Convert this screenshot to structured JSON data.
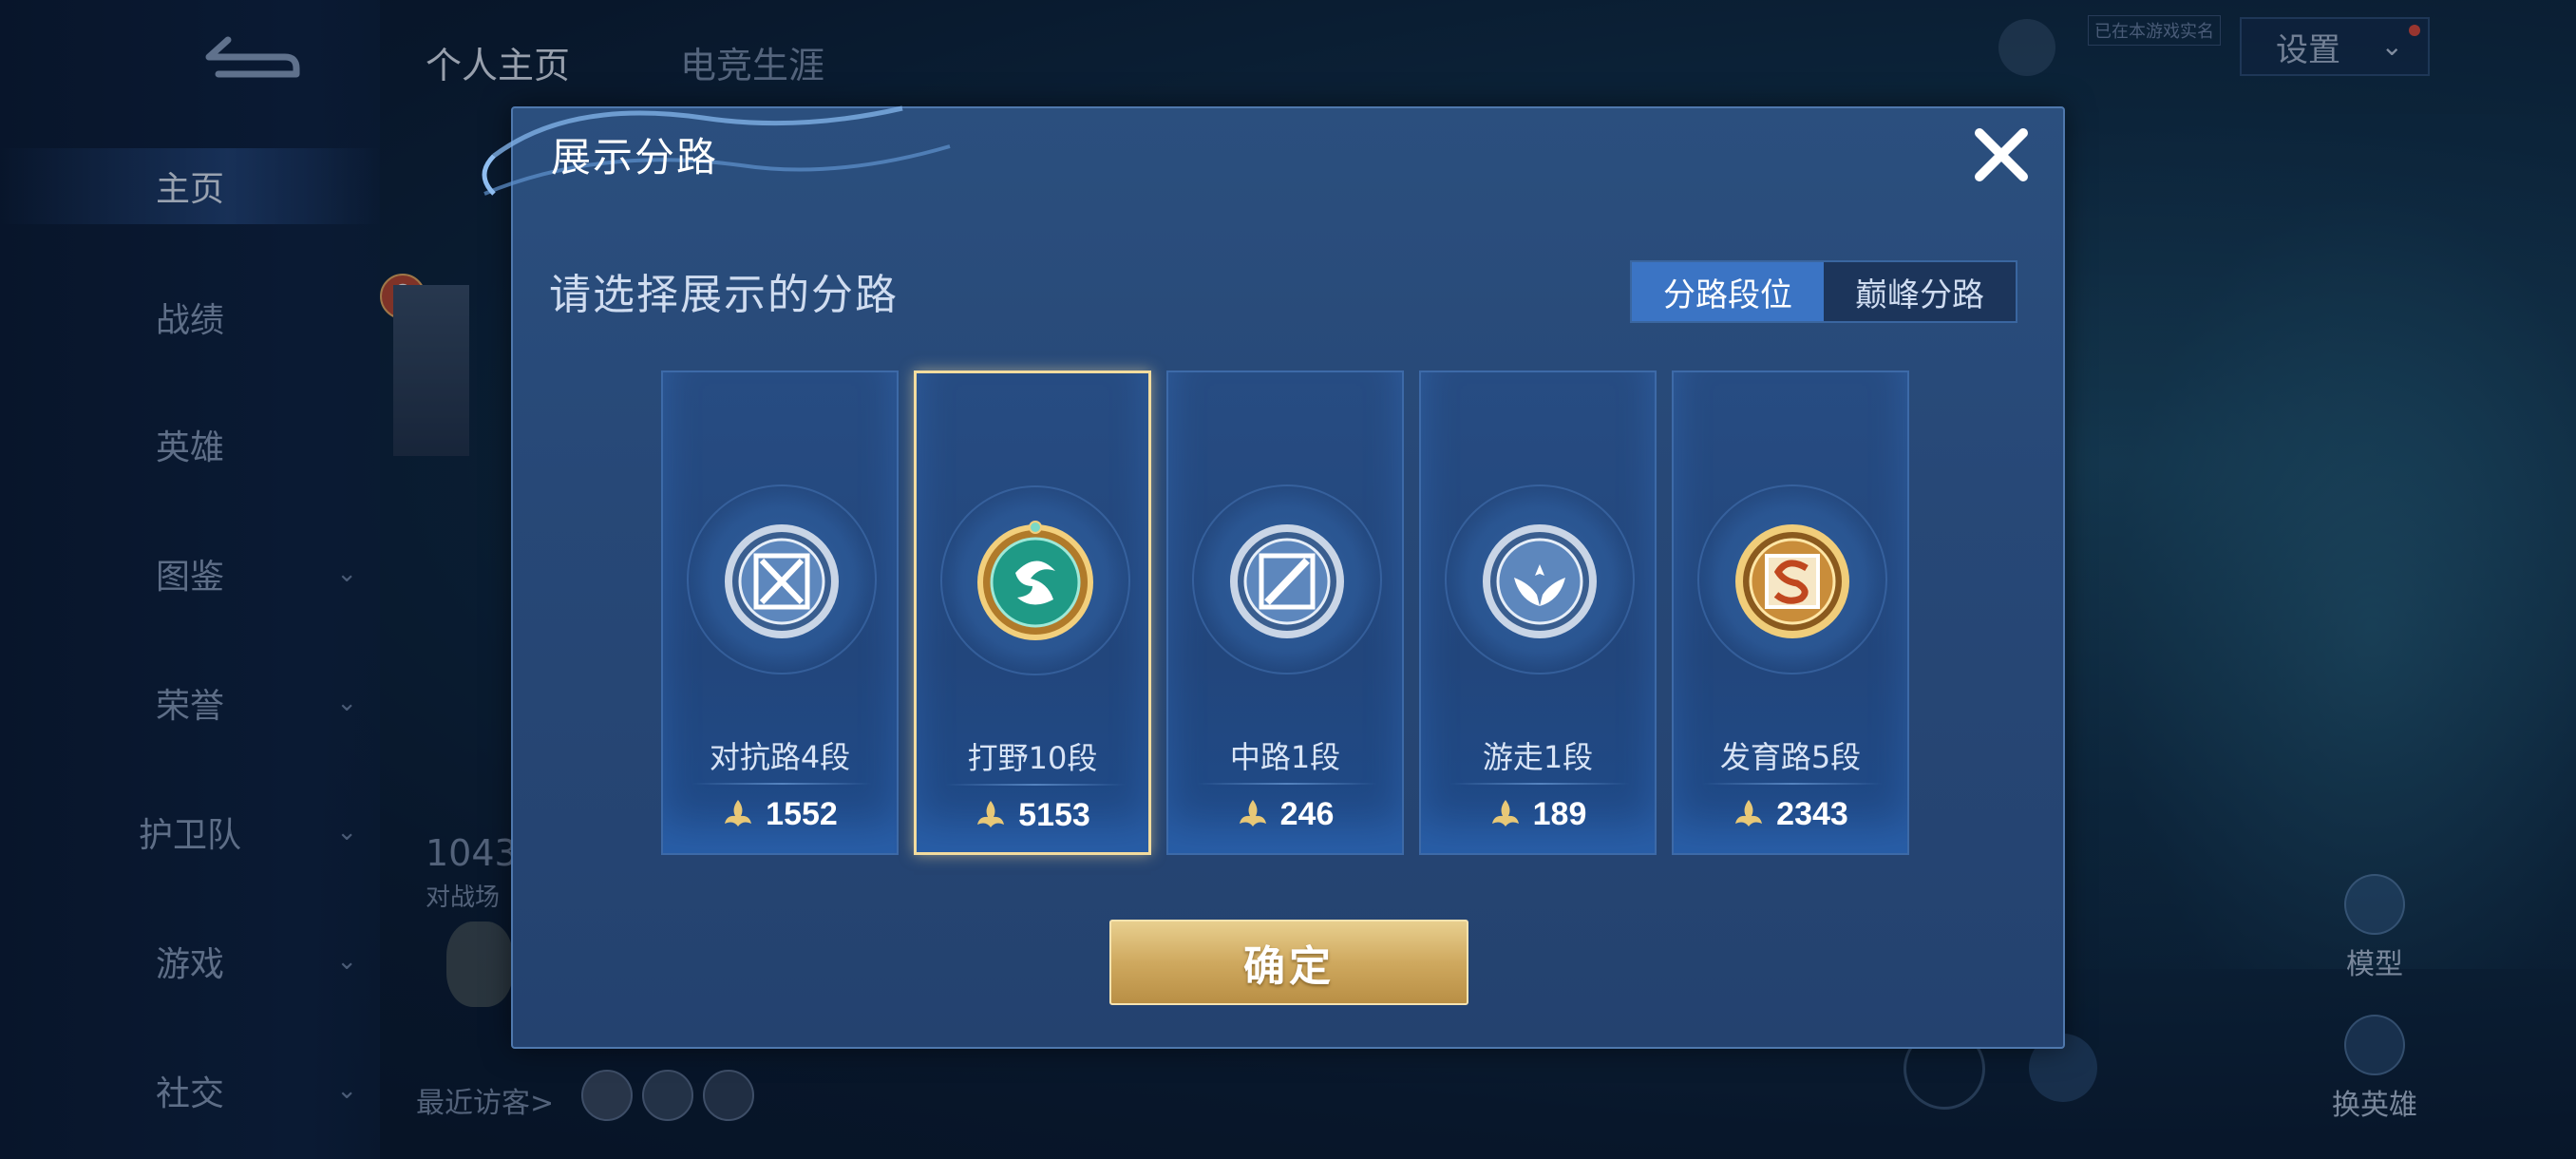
{
  "sidebar": {
    "items": [
      {
        "label": "主页",
        "active": true,
        "has_chevron": false
      },
      {
        "label": "战绩",
        "active": false,
        "has_chevron": false
      },
      {
        "label": "英雄",
        "active": false,
        "has_chevron": false
      },
      {
        "label": "图鉴",
        "active": false,
        "has_chevron": true
      },
      {
        "label": "荣誉",
        "active": false,
        "has_chevron": true
      },
      {
        "label": "护卫队",
        "active": false,
        "has_chevron": true
      },
      {
        "label": "游戏",
        "active": false,
        "has_chevron": true
      },
      {
        "label": "社交",
        "active": false,
        "has_chevron": true
      }
    ],
    "chevron_glyph": "⌄"
  },
  "top_tabs": [
    {
      "label": "个人主页",
      "active": true
    },
    {
      "label": "电竞生涯",
      "active": false
    }
  ],
  "header": {
    "settings_label": "设置",
    "status_tag": "已在本游戏实名"
  },
  "background": {
    "rank_badge_number": "8",
    "stat_number": "1043",
    "stat_caption": "对战场",
    "recent_visitors_label": "最近访客>"
  },
  "right_buttons": {
    "model_label": "模型",
    "change_hero_label": "换英雄"
  },
  "dialog": {
    "title": "展示分路",
    "prompt": "请选择展示的分路",
    "toggle": [
      {
        "label": "分路段位",
        "selected": true
      },
      {
        "label": "巅峰分路",
        "selected": false
      }
    ],
    "cards": [
      {
        "name": "对抗路4段",
        "score": "1552",
        "selected": false,
        "icon": "clash-lane-emblem"
      },
      {
        "name": "打野10段",
        "score": "5153",
        "selected": true,
        "icon": "jungle-dragon-emblem"
      },
      {
        "name": "中路1段",
        "score": "246",
        "selected": false,
        "icon": "mid-lane-emblem"
      },
      {
        "name": "游走1段",
        "score": "189",
        "selected": false,
        "icon": "roam-wings-emblem"
      },
      {
        "name": "发育路5段",
        "score": "2343",
        "selected": false,
        "icon": "farm-lane-emblem"
      }
    ],
    "confirm_label": "确定",
    "close_icon": "close-icon"
  },
  "colors": {
    "dialog_bg": "#274877",
    "toggle_selected": "#3b74c4",
    "confirm_gold": "#cfa95f",
    "selected_border": "#f3dc9e"
  }
}
